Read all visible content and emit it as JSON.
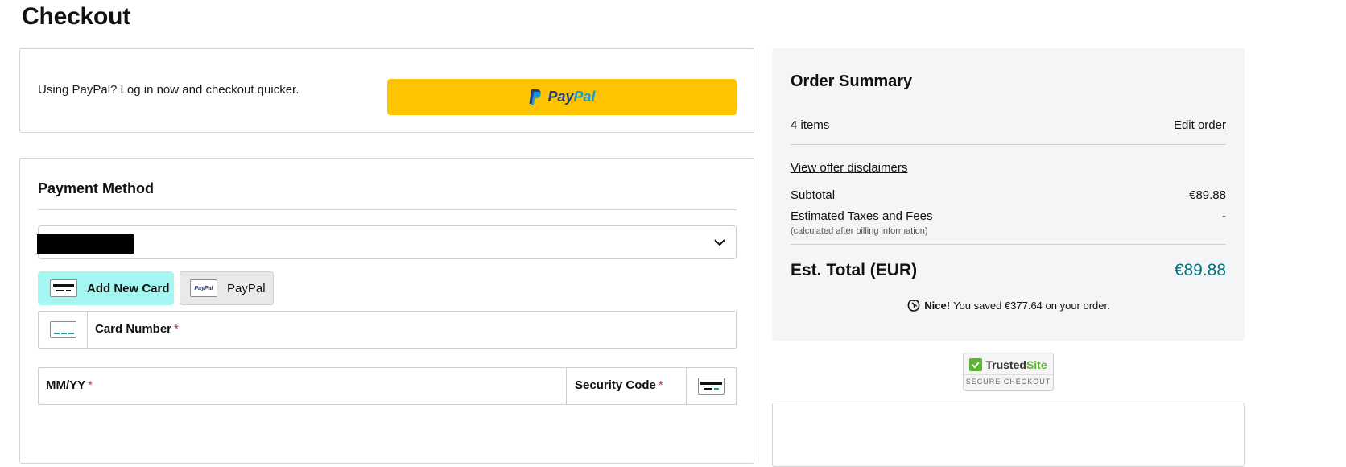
{
  "page": {
    "title": "Checkout"
  },
  "paypal_express": {
    "prompt": "Using PayPal? Log in now and checkout quicker.",
    "button_pay": "Pay",
    "button_pal": "Pal",
    "button_color": "#ffc400"
  },
  "payment": {
    "title": "Payment Method",
    "saved_method_value": "",
    "add_card_label": "Add New Card",
    "paypal_label": "PayPal",
    "paypal_icon_text": "PayPal",
    "card_number_label": "Card Number",
    "expiry_label": "MM/YY",
    "security_code_label": "Security Code",
    "required_mark": "*",
    "active_tab_color": "#a4f7f0"
  },
  "summary": {
    "title": "Order Summary",
    "items_count": "4 items",
    "edit_order": "Edit order",
    "offer_link": "View offer disclaimers",
    "subtotal_label": "Subtotal",
    "subtotal_value": "€89.88",
    "taxes_label": "Estimated Taxes and Fees",
    "taxes_note": "(calculated after billing information)",
    "taxes_value": "-",
    "total_label": "Est. Total (EUR)",
    "total_value": "€89.88",
    "total_color": "#00727a",
    "savings_nice": "Nice!",
    "savings_text": "You saved €377.64 on your order."
  },
  "trusted": {
    "trusted": "Trusted",
    "site": "Site",
    "sub": "SECURE CHECKOUT"
  }
}
